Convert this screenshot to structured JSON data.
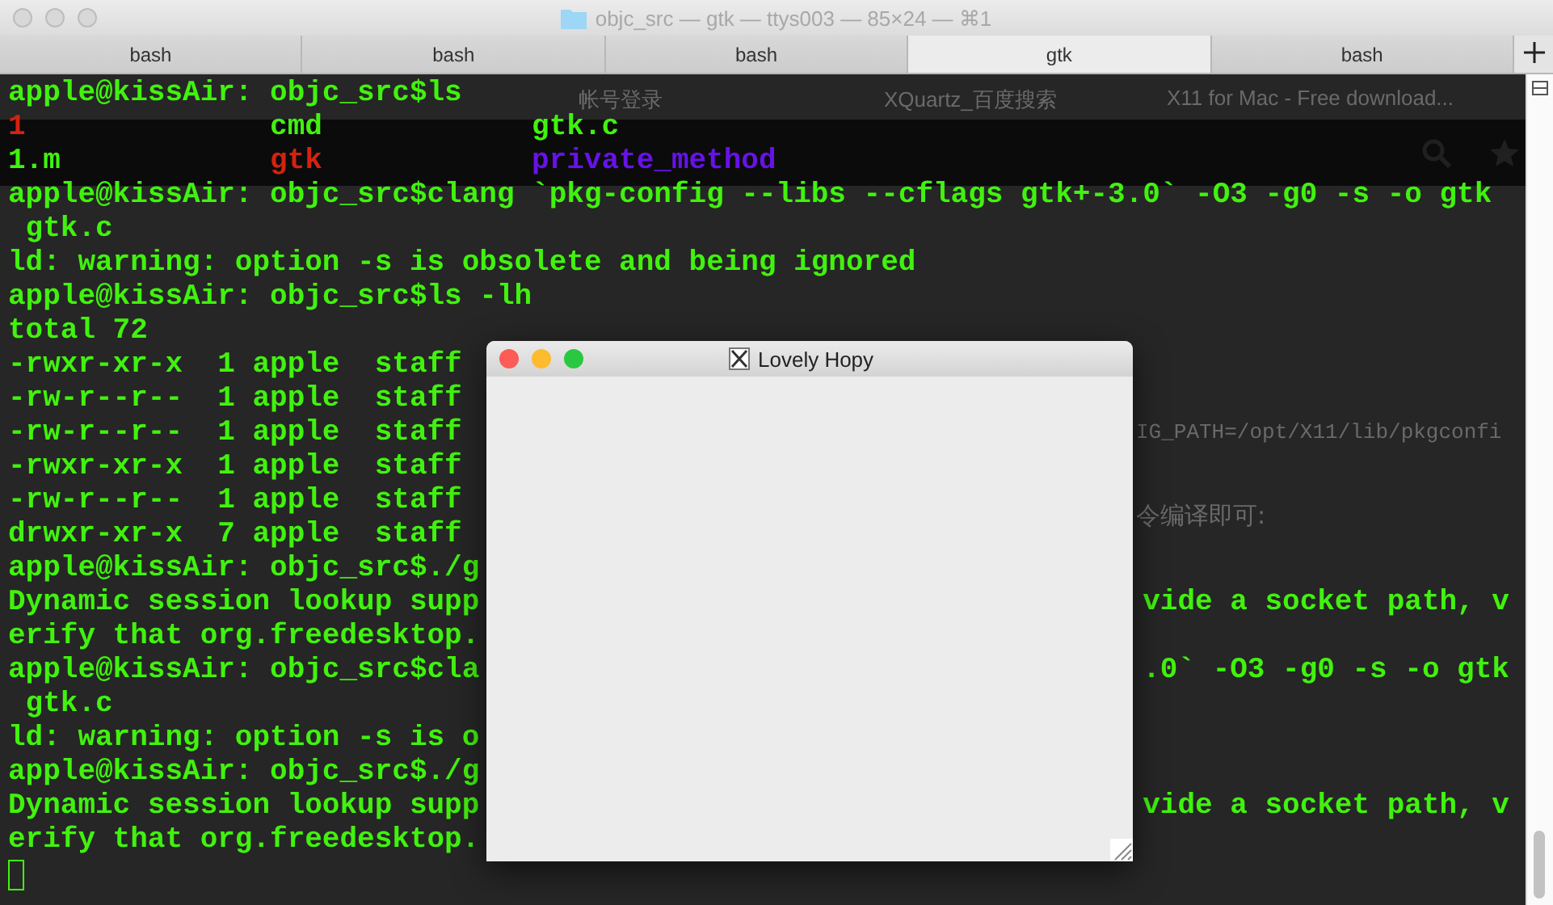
{
  "window": {
    "title": "objc_src — gtk — ttys003 — 85×24 — ⌘1"
  },
  "tabs": [
    {
      "label": "bash",
      "selected": false
    },
    {
      "label": "bash",
      "selected": false
    },
    {
      "label": "bash",
      "selected": false
    },
    {
      "label": "gtk",
      "selected": true
    },
    {
      "label": "bash",
      "selected": false
    }
  ],
  "background_page": {
    "tabs": [
      "帐号登录",
      "XQuartz_百度搜索",
      "X11 for Mac - Free download..."
    ],
    "text_lines": [
      "IG_PATH=/opt/X11/lib/pkgconfi",
      "令编译即可:"
    ]
  },
  "terminal": {
    "lines": [
      {
        "kind": "line",
        "text": "apple@kissAir: objc_src$ls"
      },
      {
        "kind": "columns",
        "cells": [
          {
            "text": "1",
            "color": "#d3230f"
          },
          {
            "text": "cmd",
            "color": "#41f20e"
          },
          {
            "text": "gtk.c",
            "color": "#41f20e"
          }
        ]
      },
      {
        "kind": "columns",
        "cells": [
          {
            "text": "1.m",
            "color": "#41f20e"
          },
          {
            "text": "gtk",
            "color": "#d3230f"
          },
          {
            "text": "private_method",
            "color": "#6712e8"
          }
        ]
      },
      {
        "kind": "line",
        "text": "apple@kissAir: objc_src$clang `pkg-config --libs --cflags gtk+-3.0` -O3 -g0 -s -o gtk"
      },
      {
        "kind": "line",
        "text": " gtk.c"
      },
      {
        "kind": "line",
        "text": "ld: warning: option -s is obsolete and being ignored"
      },
      {
        "kind": "line",
        "text": "apple@kissAir: objc_src$ls -lh"
      },
      {
        "kind": "line",
        "text": "total 72"
      },
      {
        "kind": "line",
        "text": "-rwxr-xr-x  1 apple  staff"
      },
      {
        "kind": "line",
        "text": "-rw-r--r--  1 apple  staff"
      },
      {
        "kind": "line",
        "text": "-rw-r--r--  1 apple  staff"
      },
      {
        "kind": "line",
        "text": "-rwxr-xr-x  1 apple  staff"
      },
      {
        "kind": "line",
        "text": "-rw-r--r--  1 apple  staff"
      },
      {
        "kind": "line",
        "text": "drwxr-xr-x  7 apple  staff"
      },
      {
        "kind": "line",
        "text": "apple@kissAir: objc_src$./g"
      },
      {
        "kind": "line",
        "text": "Dynamic session lookup supp",
        "continued": "vide a socket path, v"
      },
      {
        "kind": "line",
        "text": "erify that org.freedesktop."
      },
      {
        "kind": "line",
        "text": "apple@kissAir: objc_src$cla",
        "continued": ".0` -O3 -g0 -s -o gtk"
      },
      {
        "kind": "line",
        "text": " gtk.c"
      },
      {
        "kind": "line",
        "text": "ld: warning: option -s is o"
      },
      {
        "kind": "line",
        "text": "apple@kissAir: objc_src$./g"
      },
      {
        "kind": "line",
        "text": "Dynamic session lookup supp",
        "continued": "vide a socket path, v"
      },
      {
        "kind": "line",
        "text": "erify that org.freedesktop."
      },
      {
        "kind": "cursor"
      }
    ]
  },
  "gtk_window": {
    "title": "Lovely Hopy"
  }
}
